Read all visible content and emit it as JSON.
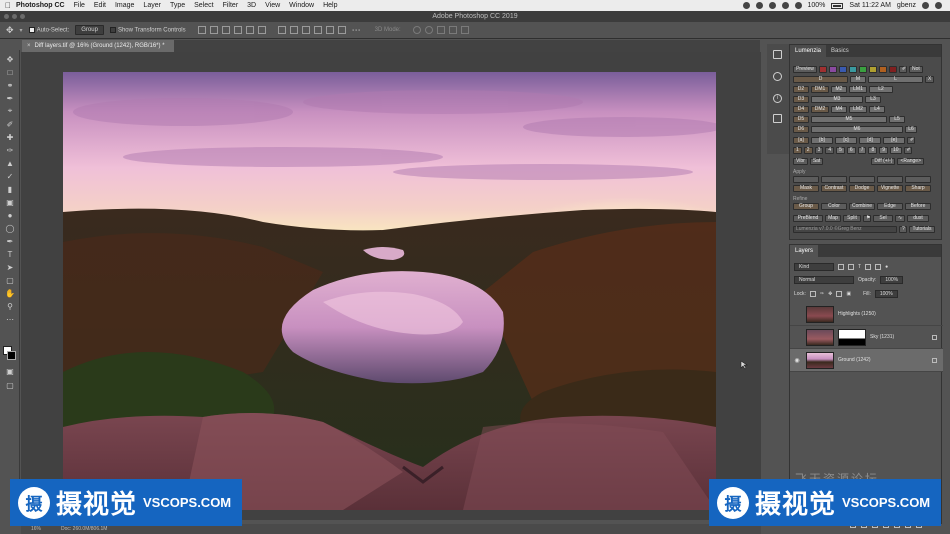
{
  "menubar": {
    "app_name": "Photoshop CC",
    "items": [
      "File",
      "Edit",
      "Image",
      "Layer",
      "Type",
      "Select",
      "Filter",
      "3D",
      "View",
      "Window",
      "Help"
    ],
    "battery": "100%",
    "clock": "Sat 11:22 AM",
    "user": "gbenz"
  },
  "window": {
    "title": "Adobe Photoshop CC 2019"
  },
  "options_bar": {
    "auto_select_label": "Auto-Select:",
    "auto_select_value": "Group",
    "transform_controls_label": "Show Transform Controls",
    "mode_3d_label": "3D Mode:"
  },
  "document": {
    "tab_title": "Diff layers.tif @ 16% (Ground (1242), RGB/16*) *",
    "zoom": "16%",
    "doc_size": "Doc: 260.0M/806.1M"
  },
  "luminosity_panel": {
    "tabs": [
      "Lumenzia",
      "Basics"
    ],
    "active_tab": "Lumenzia",
    "preview_label": "Preview",
    "none_label": "Not",
    "x_label": "X",
    "row_dark": [
      "D",
      "M",
      "L"
    ],
    "row_d2": [
      "D2",
      "DM1",
      "M2",
      "LM1",
      "L2"
    ],
    "row_d3": [
      "D3",
      "M3",
      "L3"
    ],
    "row_d4": [
      "D4",
      "DM2",
      "M4",
      "LM2",
      "L4"
    ],
    "row_d5": [
      "D5",
      "M5",
      "L5"
    ],
    "row_d6": [
      "D6",
      "M6",
      "L6"
    ],
    "zone_row": [
      "[a]",
      "[b]",
      "[c]",
      "[d]",
      "[e]"
    ],
    "num_row": [
      "1",
      "2",
      "3",
      "4",
      "5",
      "6",
      "7",
      "8",
      "9",
      "10"
    ],
    "vibr_label": "Vibr",
    "sat_label": "Sat",
    "diff_label": "Diff (+/-)",
    "range_label": "<Range>",
    "apply_label": "Apply",
    "apply_buttons": [
      "Mask",
      "Contrast",
      "Dodge",
      "Vignette",
      "Sharp"
    ],
    "refine_label": "Refine",
    "refine_buttons": [
      "Group",
      "Color",
      "Combine",
      "Edge",
      "Before"
    ],
    "tools_buttons": [
      "PreBlend",
      "Map",
      "Split",
      "Sel",
      "dust"
    ],
    "version": "Lumenzia v7.0.0 ©Greg Benz",
    "tutorials_label": "Tutorials"
  },
  "layers_panel": {
    "tab": "Layers",
    "filter_kind": "Kind",
    "blend_mode": "Normal",
    "opacity_label": "Opacity:",
    "opacity_value": "100%",
    "lock_label": "Lock:",
    "fill_label": "Fill:",
    "fill_value": "100%",
    "layers": [
      {
        "name": "Highlights (1250)",
        "visible": false,
        "has_mask": false,
        "active": false
      },
      {
        "name": "Sky (1231)",
        "visible": false,
        "has_mask": true,
        "active": false
      },
      {
        "name": "Ground (1242)",
        "visible": true,
        "has_mask": false,
        "active": true
      }
    ]
  },
  "watermark": {
    "cn_text": "飞天资源论坛",
    "brand_cn": "摄视觉",
    "brand_en": "VSCOPS.COM",
    "logo_char": "摄"
  },
  "colors": {
    "ui_panel": "#535353",
    "canvas_bg": "#414141",
    "badge_blue": "#1565c0"
  }
}
